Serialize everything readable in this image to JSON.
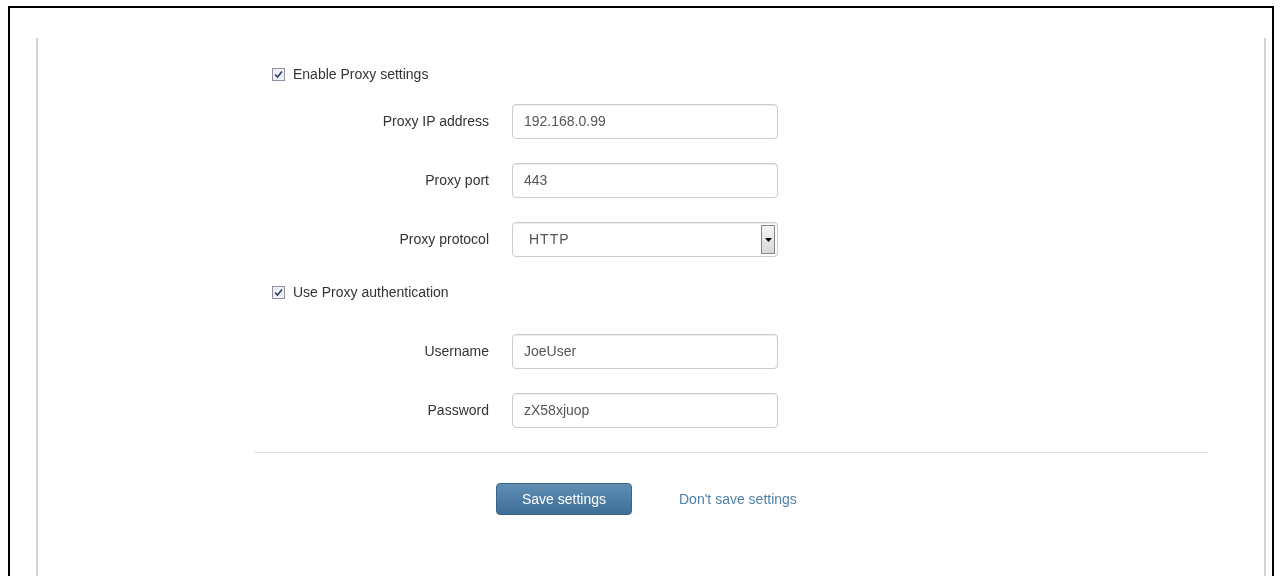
{
  "enable_proxy": {
    "label": "Enable Proxy settings",
    "checked": true
  },
  "proxy_fields": [
    {
      "kind": "text",
      "label": "Proxy IP address",
      "value": "192.168.0.99"
    },
    {
      "kind": "text",
      "label": "Proxy port",
      "value": "443"
    },
    {
      "kind": "select",
      "label": "Proxy protocol",
      "value": "HTTP"
    }
  ],
  "use_auth": {
    "label": "Use Proxy authentication",
    "checked": true
  },
  "auth_fields": [
    {
      "kind": "text",
      "label": "Username",
      "value": "JoeUser"
    },
    {
      "kind": "text",
      "label": "Password",
      "value": "zX58xjuop"
    }
  ],
  "buttons": {
    "save": "Save settings",
    "cancel": "Don't save settings"
  }
}
